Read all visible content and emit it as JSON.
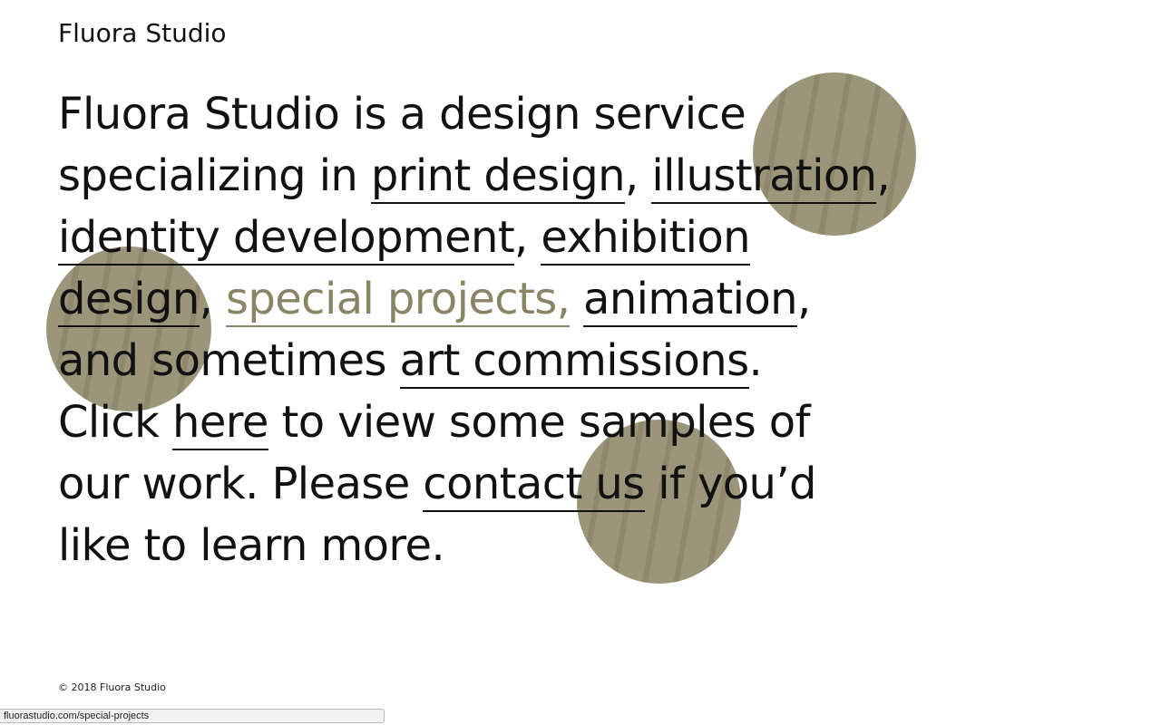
{
  "header": {
    "logo": "Fluora Studio"
  },
  "intro": {
    "t1": "Fluora Studio is a design service",
    "t2": "specializing in ",
    "link_print_design": "print design",
    "sep1": ", ",
    "link_illustration": "illustration",
    "sep2": ",",
    "link_identity_development": "identity development",
    "sep3": ", ",
    "link_exhibition_design_a": "exhibition",
    "link_exhibition_design_b": "design",
    "sep4": ", ",
    "link_special_projects": "special projects,",
    "sep5": " ",
    "link_animation": "animation",
    "sep6": ",",
    "t3": "and sometimes ",
    "link_art_commissions": "art commissions",
    "t4": ".",
    "t5": "Click ",
    "link_here": "here",
    "t6": " to view some samples of",
    "t7": "our work. Please ",
    "link_contact_us": "contact us",
    "t8": " if you’d",
    "t9": "like to learn more."
  },
  "footer": {
    "copyright": "© 2018 Fluora Studio"
  },
  "status_bar": {
    "url": "fluorastudio.com/special-projects"
  },
  "colors": {
    "text": "#111111",
    "muted_link": "#8a8466",
    "image_blob": "#8e8769",
    "background": "#ffffff"
  }
}
